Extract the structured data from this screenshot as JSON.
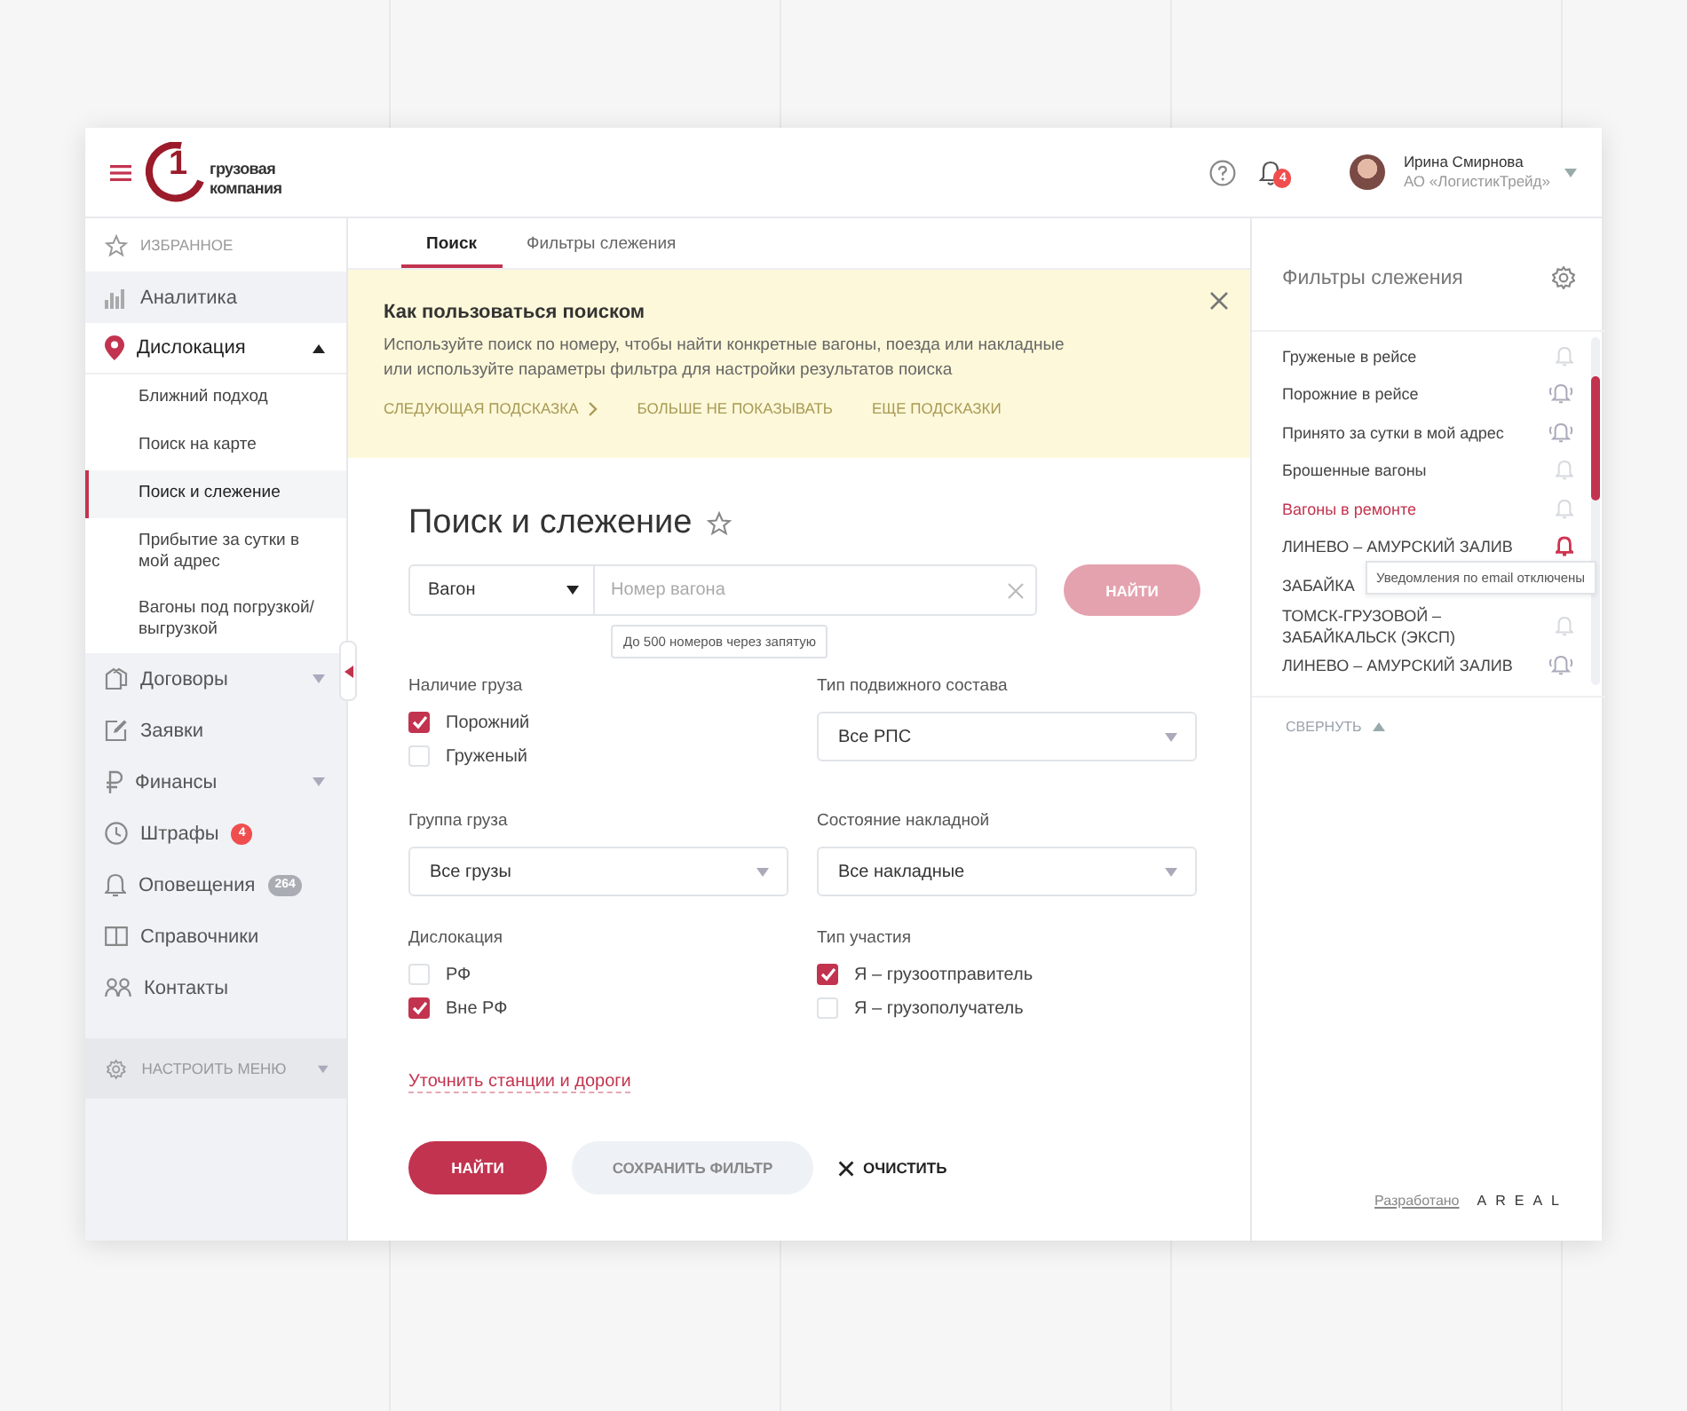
{
  "header": {
    "logo": {
      "numeral": "1",
      "line1": "грузовая",
      "line2": "компания"
    },
    "notifications_count": "4",
    "user": {
      "name": "Ирина Смирнова",
      "company": "АО «ЛогистикТрейд»"
    }
  },
  "sidebar": {
    "favorites": "ИЗБРАННОЕ",
    "items": [
      {
        "label": "Аналитика"
      },
      {
        "label": "Дислокация",
        "expanded": true,
        "children": [
          {
            "label": "Ближний подход",
            "selected": false
          },
          {
            "label": "Поиск на карте",
            "selected": false
          },
          {
            "label": "Поиск и слежение",
            "selected": true
          },
          {
            "label": "Прибытие за сутки в мой адрес",
            "selected": false
          },
          {
            "label": "Вагоны под погрузкой/выгрузкой",
            "selected": false
          }
        ]
      },
      {
        "label": "Договоры",
        "expanded": false
      },
      {
        "label": "Заявки"
      },
      {
        "label": "Финансы",
        "expanded": false
      },
      {
        "label": "Штрафы",
        "badge": "4",
        "color": "#f04e4e"
      },
      {
        "label": "Оповещения",
        "badge": "264",
        "color": "#a9adb3"
      },
      {
        "label": "Справочники"
      },
      {
        "label": "Контакты"
      }
    ],
    "settings": "НАСТРОИТЬ МЕНЮ"
  },
  "tabs": [
    {
      "label": "Поиск",
      "selected": true
    },
    {
      "label": "Фильтры слежения",
      "selected": false
    }
  ],
  "tip": {
    "title": "Как пользоваться поиском",
    "text": "Используйте поиск по номеру, чтобы найти конкретные вагоны, поезда или накладные или используйте параметры фильтра для настройки результатов поиска",
    "actions": [
      {
        "label": "СЛЕДУЮЩАЯ ПОДСКАЗКА",
        "chevron": true
      },
      {
        "label": "БОЛЬШЕ НЕ ПОКАЗЫВАТЬ"
      },
      {
        "label": "ЕЩЕ ПОДСКАЗКИ"
      }
    ]
  },
  "form": {
    "title": "Поиск и слежение",
    "search": {
      "type": "Вагон",
      "placeholder": "Номер вагона",
      "button": "НАЙТИ",
      "disabled": true,
      "hint": "До 500 номеров через запятую"
    },
    "fields": [
      {
        "kind": "checkboxes",
        "label": "Наличие груза",
        "options": [
          {
            "label": "Порожний",
            "checked": true
          },
          {
            "label": "Груженый",
            "checked": false
          }
        ]
      },
      {
        "kind": "select",
        "label": "Тип подвижного состава",
        "value": "Все РПС"
      },
      {
        "kind": "select",
        "label": "Группа груза",
        "value": "Все грузы"
      },
      {
        "kind": "select",
        "label": "Состояние накладной",
        "value": "Все накладные"
      },
      {
        "kind": "checkboxes",
        "label": "Дислокация",
        "options": [
          {
            "label": "РФ",
            "checked": false
          },
          {
            "label": "Вне РФ",
            "checked": true
          }
        ]
      },
      {
        "kind": "checkboxes",
        "label": "Тип участия",
        "options": [
          {
            "label": "Я – грузоотправитель",
            "checked": true
          },
          {
            "label": "Я – грузополучатель",
            "checked": false
          }
        ]
      }
    ],
    "link": "Уточнить станции и дороги",
    "buttons": {
      "find": "НАЙТИ",
      "save": "СОХРАНИТЬ ФИЛЬТР",
      "clear": "ОЧИСТИТЬ"
    }
  },
  "filters_panel": {
    "title": "Фильтры слежения",
    "items": [
      {
        "label": "Груженые в рейсе",
        "selected": false,
        "kind": "off"
      },
      {
        "label": "Порожние в рейсе",
        "selected": false,
        "kind": "ringing"
      },
      {
        "label": "Принято за сутки в мой адрес",
        "selected": false,
        "kind": "ringing"
      },
      {
        "label": "Брошенные вагоны",
        "selected": false,
        "kind": "off"
      },
      {
        "label": "Вагоны в ремонте",
        "selected": true,
        "kind": "off"
      },
      {
        "label": "ЛИНЕВО – АМУРСКИЙ ЗАЛИВ",
        "selected": false,
        "kind": "alert",
        "tooltip": "Уведомления по email отключены"
      },
      {
        "label": "ЗАБАЙКА",
        "selected": false
      },
      {
        "label": "ТОМСК-ГРУЗОВОЙ – ЗАБАЙКАЛЬСК (ЭКСП)",
        "selected": false,
        "kind": "off"
      },
      {
        "label": "ЛИНЕВО – АМУРСКИЙ ЗАЛИВ",
        "selected": false,
        "kind": "ringing"
      }
    ],
    "collapse": "СВЕРНУТЬ",
    "credit": "Разработано",
    "credit_logo": "AREAL"
  }
}
